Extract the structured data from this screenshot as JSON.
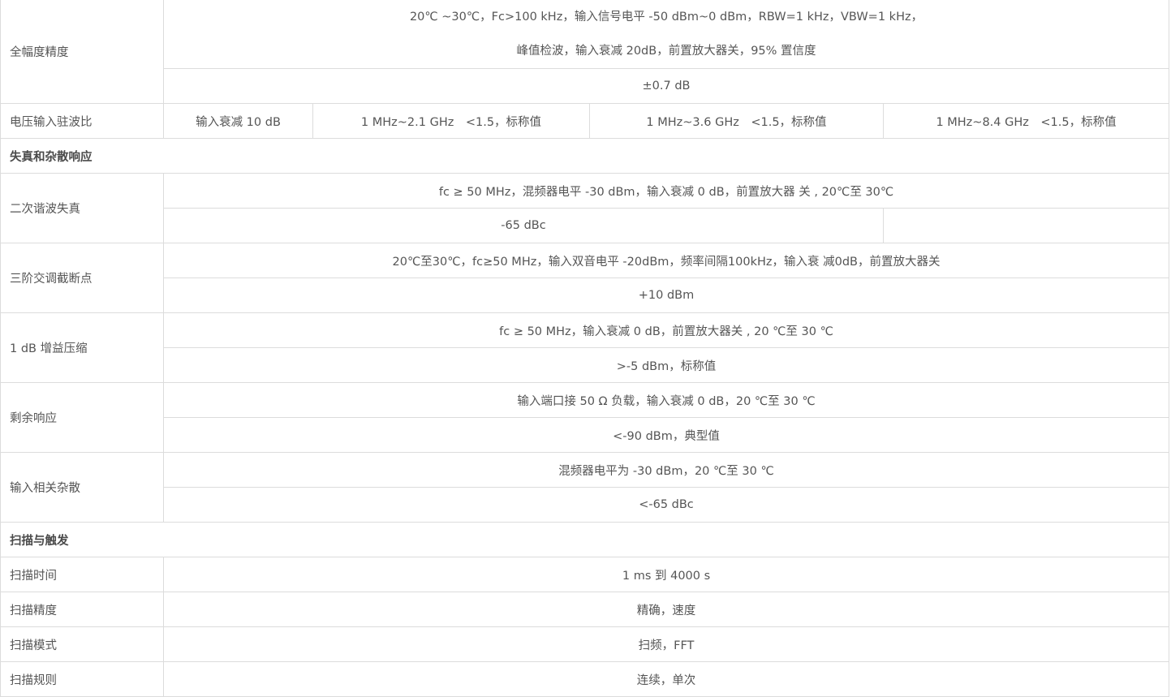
{
  "amplitude_accuracy": {
    "label": "全幅度精度",
    "condition_line1": "20℃ ~30℃，Fc>100 kHz，输入信号电平 -50 dBm~0 dBm，RBW=1 kHz，VBW=1 kHz，",
    "condition_line2": "峰值检波，输入衰减 20dB，前置放大器关，95% 置信度",
    "value": "±0.7 dB"
  },
  "vswr": {
    "label": "电压输入驻波比",
    "attenuation": "输入衰减 10 dB",
    "ranges": [
      "1 MHz~2.1 GHz　<1.5，标称值",
      "1 MHz~3.6 GHz　<1.5，标称值",
      "1 MHz~8.4 GHz　<1.5，标称值"
    ]
  },
  "section_distortion": "失真和杂散响应",
  "second_harmonic": {
    "label": "二次谐波失真",
    "condition": "fc ≥ 50 MHz，混频器电平 -30 dBm，输入衰减 0 dB，前置放大器 关 , 20℃至 30℃",
    "value": "-65 dBc"
  },
  "toi": {
    "label": "三阶交调截断点",
    "condition": "20℃至30℃，fc≥50 MHz，输入双音电平 -20dBm，频率间隔100kHz，输入衰 减0dB，前置放大器关",
    "value": "+10 dBm"
  },
  "compression": {
    "label": "1 dB 增益压缩",
    "condition": "fc ≥ 50 MHz，输入衰减 0 dB，前置放大器关 , 20 ℃至 30 ℃",
    "value": ">-5 dBm，标称值"
  },
  "residual": {
    "label": "剩余响应",
    "condition": "输入端口接 50 Ω 负载，输入衰减 0 dB，20 ℃至 30 ℃",
    "value": "<-90 dBm，典型值"
  },
  "input_spurious": {
    "label": "输入相关杂散",
    "condition": "混频器电平为 -30 dBm，20 ℃至 30 ℃",
    "value": "<-65 dBc"
  },
  "section_sweep": "扫描与触发",
  "sweep_time": {
    "label": "扫描时间",
    "value": "1 ms 到 4000 s"
  },
  "sweep_accuracy": {
    "label": "扫描精度",
    "value": "精确，速度"
  },
  "sweep_mode": {
    "label": "扫描模式",
    "value": "扫频，FFT"
  },
  "sweep_rule": {
    "label": "扫描规则",
    "value": "连续，单次"
  }
}
